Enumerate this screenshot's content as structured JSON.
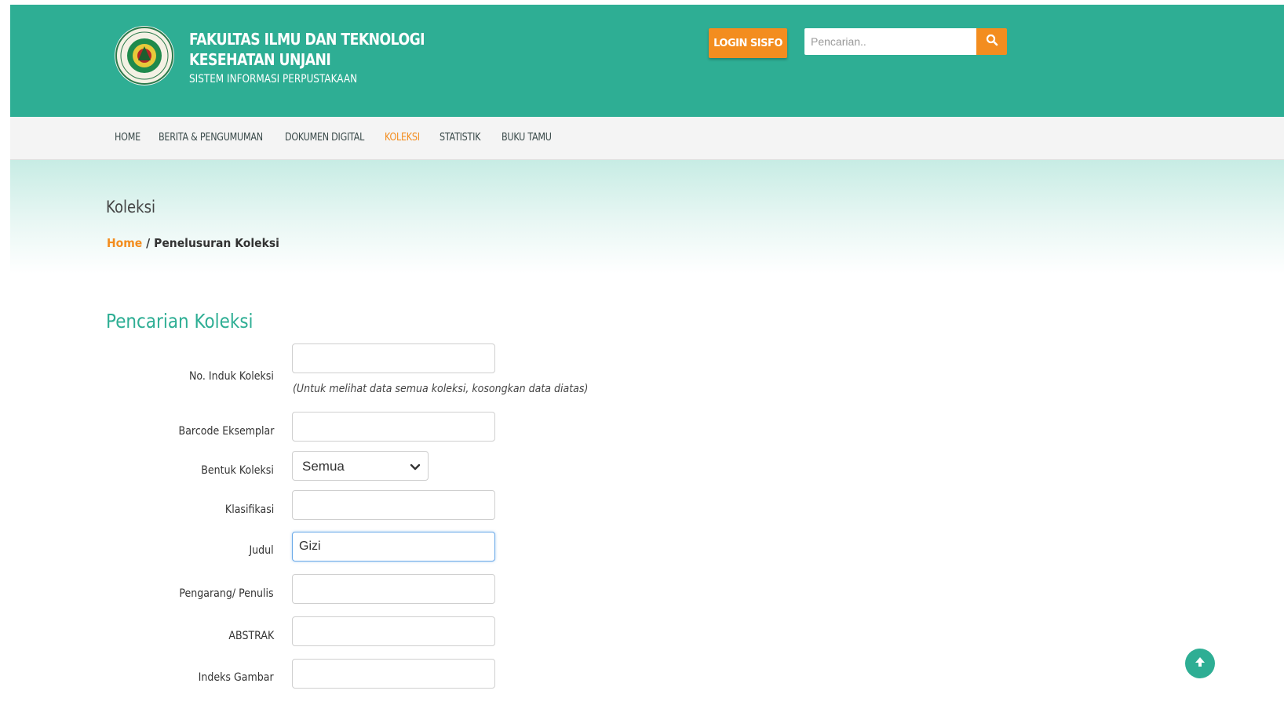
{
  "header": {
    "title_line1": "FAKULTAS ILMU DAN TEKNOLOGI",
    "title_line2": "KESEHATAN UNJANI",
    "subtitle": "SISTEM INFORMASI PERPUSTAKAAN",
    "login_label": "LOGIN SISFO",
    "search_placeholder": "Pencarian..",
    "brand_color": "#2eae94",
    "accent_color": "#f38d1f"
  },
  "nav": {
    "items": [
      {
        "label": "HOME",
        "active": false
      },
      {
        "label": "BERITA & PENGUMUMAN",
        "active": false
      },
      {
        "label": "DOKUMEN DIGITAL",
        "active": false
      },
      {
        "label": "KOLEKSI",
        "active": true
      },
      {
        "label": "STATISTIK",
        "active": false
      },
      {
        "label": "BUKU TAMU",
        "active": false
      }
    ]
  },
  "banner": {
    "title": "Koleksi",
    "breadcrumb_home": "Home",
    "breadcrumb_sep": "/",
    "breadcrumb_current": "Penelusuran Koleksi"
  },
  "form": {
    "title": "Pencarian Koleksi",
    "hint": "(Untuk melihat data semua koleksi, kosongkan data diatas)",
    "fields": {
      "no_induk": {
        "label": "No. Induk Koleksi",
        "value": ""
      },
      "barcode": {
        "label": "Barcode Eksemplar",
        "value": ""
      },
      "bentuk": {
        "label": "Bentuk Koleksi",
        "value": "Semua"
      },
      "klasifikasi": {
        "label": "Klasifikasi",
        "value": ""
      },
      "judul": {
        "label": "Judul",
        "value": "Gizi"
      },
      "pengarang": {
        "label": "Pengarang/ Penulis",
        "value": ""
      },
      "abstrak": {
        "label": "ABSTRAK",
        "value": ""
      },
      "indeks_gambar": {
        "label": "Indeks Gambar",
        "value": ""
      }
    }
  },
  "icons": {
    "search": "search-icon",
    "chevron": "chevron-down-icon",
    "scroll_top": "arrow-up-icon",
    "logo": "faculty-seal-logo"
  }
}
